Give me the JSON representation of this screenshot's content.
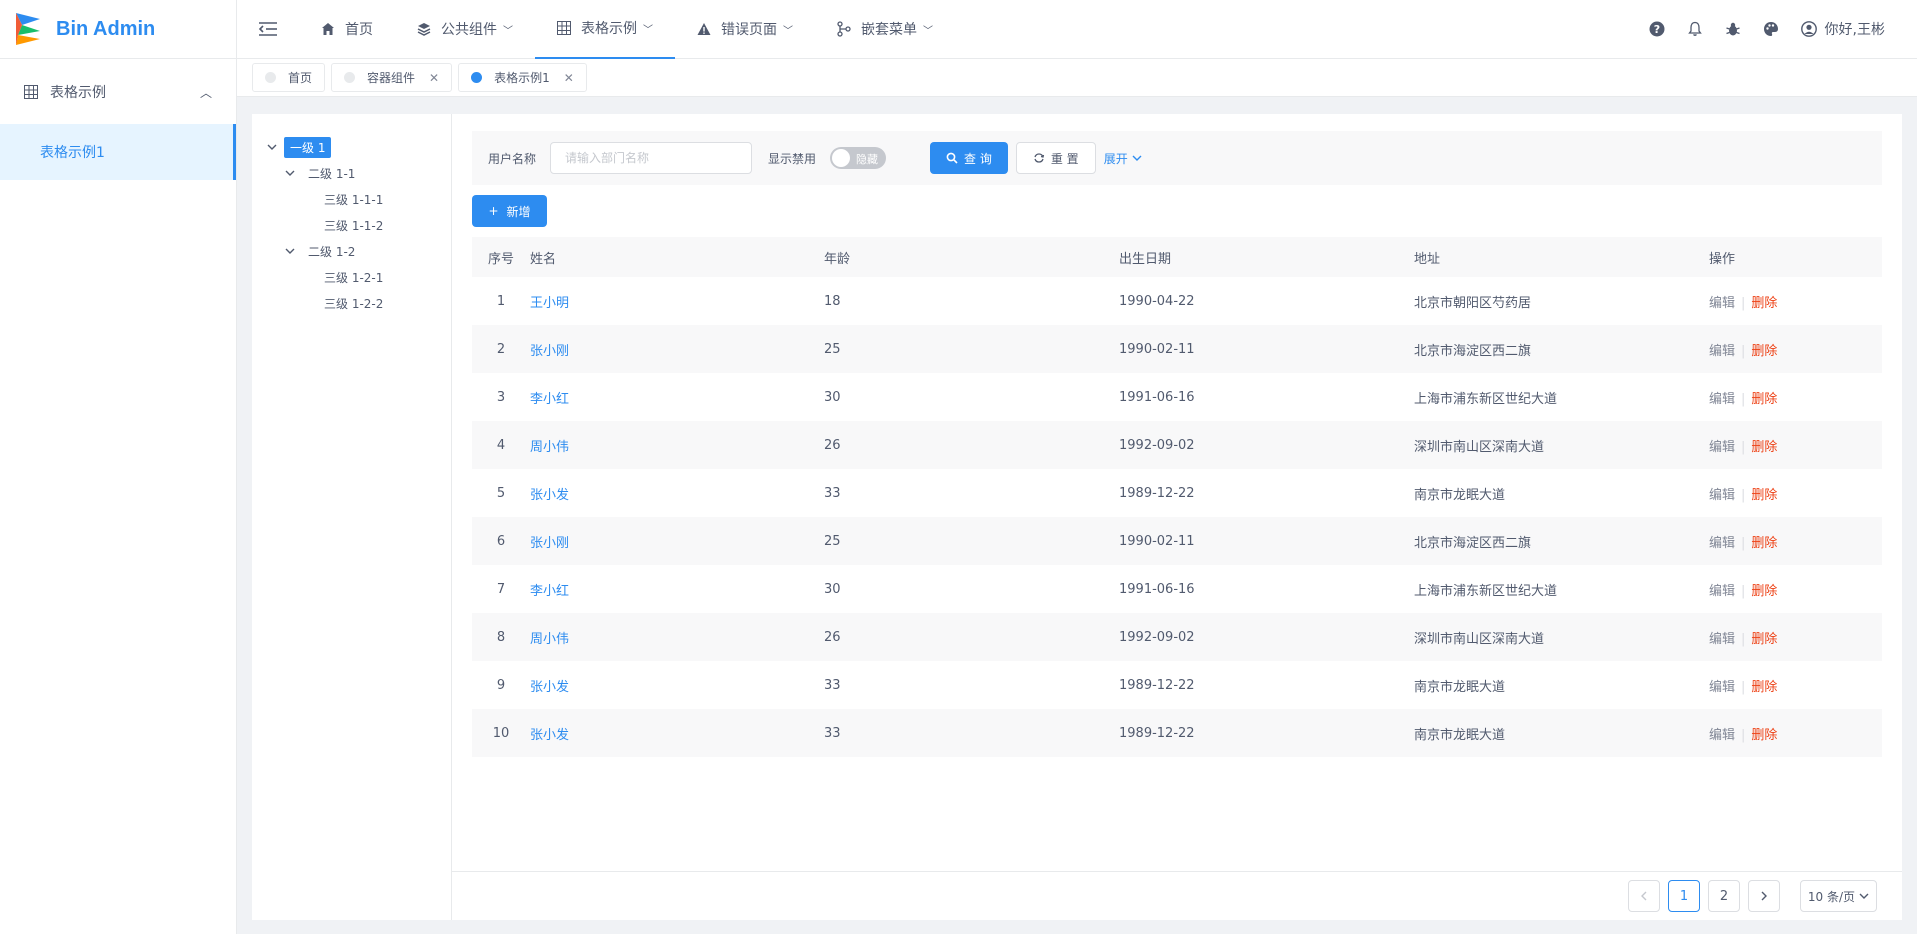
{
  "app": {
    "title": "Bin Admin",
    "accent": "#2d8cf0"
  },
  "sidebar": {
    "group_label": "表格示例",
    "items": [
      {
        "label": "表格示例1"
      }
    ]
  },
  "header": {
    "nav": [
      {
        "label": "首页",
        "icon": "home-icon"
      },
      {
        "label": "公共组件",
        "icon": "layers-icon"
      },
      {
        "label": "表格示例",
        "icon": "table-icon"
      },
      {
        "label": "错误页面",
        "icon": "warning-icon"
      },
      {
        "label": "嵌套菜单",
        "icon": "branch-icon"
      }
    ],
    "user": "你好,王彬"
  },
  "tags": [
    {
      "label": "首页"
    },
    {
      "label": "容器组件"
    },
    {
      "label": "表格示例1"
    }
  ],
  "tree": {
    "root": "一级 1",
    "children": [
      {
        "label": "二级 1-1",
        "children": [
          "三级 1-1-1",
          "三级 1-1-2"
        ]
      },
      {
        "label": "二级 1-2",
        "children": [
          "三级 1-2-1",
          "三级 1-2-2"
        ]
      }
    ]
  },
  "search": {
    "username_label": "用户名称",
    "username_placeholder": "请输入部门名称",
    "show_disabled_label": "显示禁用",
    "switch_text": "隐藏",
    "query_label": "查 询",
    "reset_label": "重 置",
    "expand_label": "展开"
  },
  "toolbar": {
    "add_label": "新增"
  },
  "table": {
    "columns": [
      "序号",
      "姓名",
      "年龄",
      "出生日期",
      "地址",
      "操作"
    ],
    "rows": [
      [
        "1",
        "王小明",
        "18",
        "1990-04-22",
        "北京市朝阳区芍药居"
      ],
      [
        "2",
        "张小刚",
        "25",
        "1990-02-11",
        "北京市海淀区西二旗"
      ],
      [
        "3",
        "李小红",
        "30",
        "1991-06-16",
        "上海市浦东新区世纪大道"
      ],
      [
        "4",
        "周小伟",
        "26",
        "1992-09-02",
        "深圳市南山区深南大道"
      ],
      [
        "5",
        "张小发",
        "33",
        "1989-12-22",
        "南京市龙眠大道"
      ],
      [
        "6",
        "张小刚",
        "25",
        "1990-02-11",
        "北京市海淀区西二旗"
      ],
      [
        "7",
        "李小红",
        "30",
        "1991-06-16",
        "上海市浦东新区世纪大道"
      ],
      [
        "8",
        "周小伟",
        "26",
        "1992-09-02",
        "深圳市南山区深南大道"
      ],
      [
        "9",
        "张小发",
        "33",
        "1989-12-22",
        "南京市龙眠大道"
      ],
      [
        "10",
        "张小发",
        "33",
        "1989-12-22",
        "南京市龙眠大道"
      ]
    ],
    "edit_label": "编辑",
    "delete_label": "删除"
  },
  "pagination": {
    "pages": [
      "1",
      "2"
    ],
    "current": "1",
    "page_size": "10 条/页"
  }
}
